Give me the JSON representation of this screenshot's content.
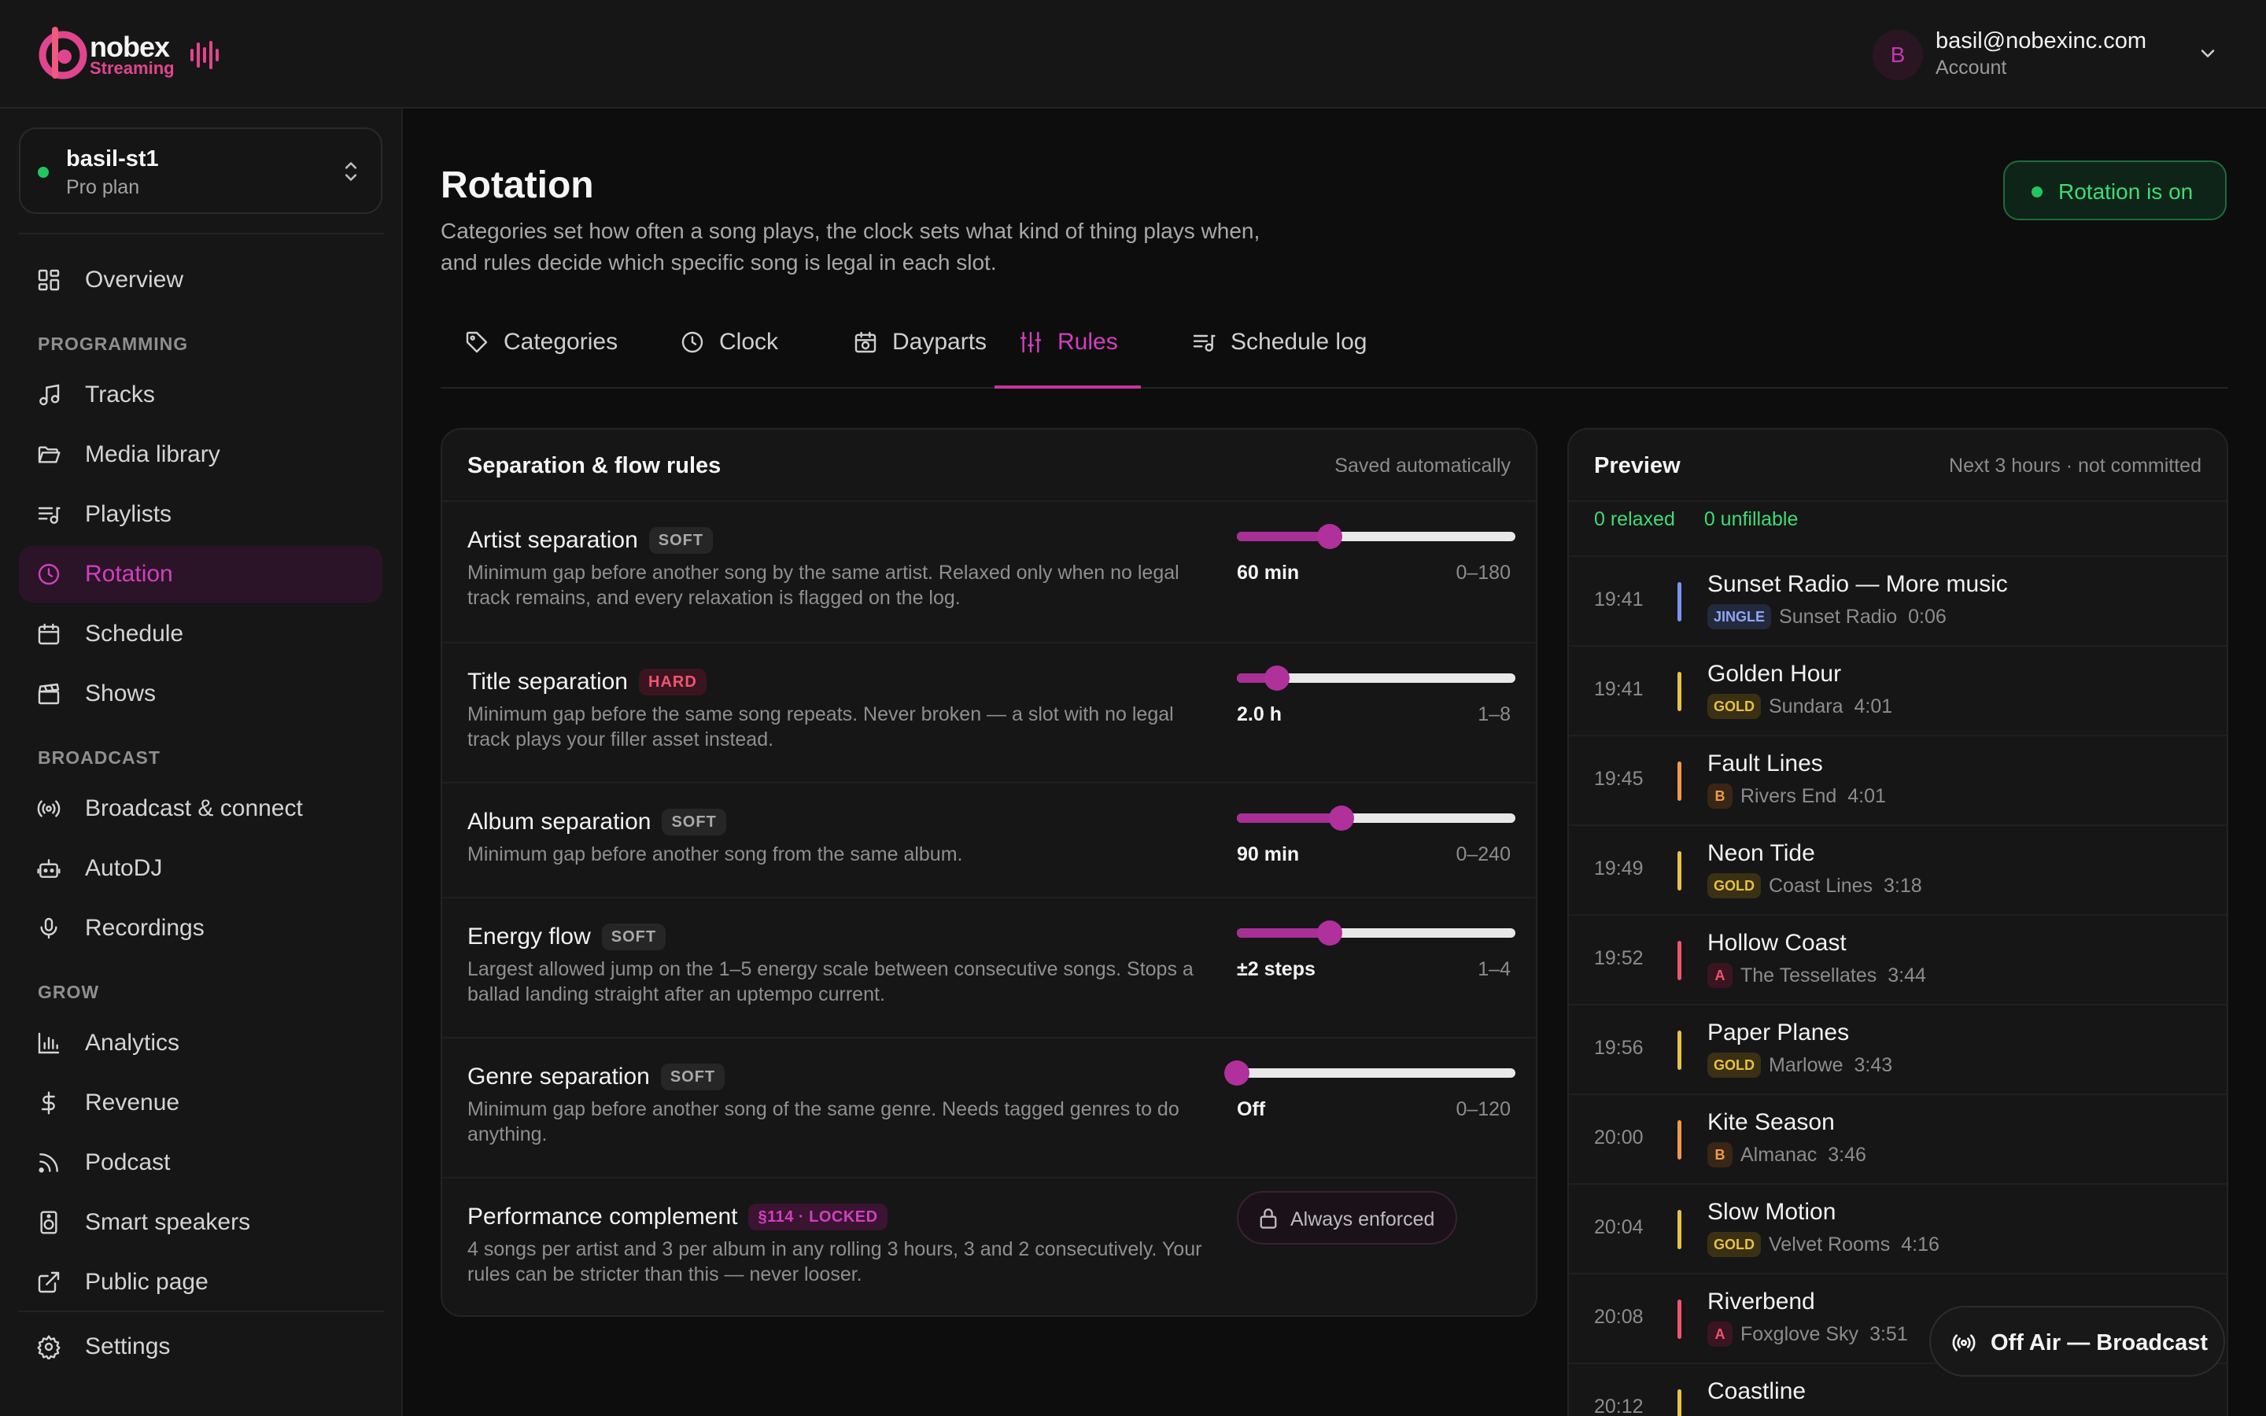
{
  "brand": {
    "name": "nobex",
    "sub": "Streaming"
  },
  "account": {
    "initial": "B",
    "email": "basil@nobexinc.com",
    "label": "Account"
  },
  "station": {
    "name": "basil-st1",
    "plan": "Pro plan",
    "status_color": "#22c55e"
  },
  "nav": {
    "overview": "Overview",
    "section_programming": "PROGRAMMING",
    "tracks": "Tracks",
    "media_library": "Media library",
    "playlists": "Playlists",
    "rotation": "Rotation",
    "schedule": "Schedule",
    "shows": "Shows",
    "section_broadcast": "BROADCAST",
    "broadcast_connect": "Broadcast & connect",
    "autodj": "AutoDJ",
    "recordings": "Recordings",
    "section_grow": "GROW",
    "analytics": "Analytics",
    "revenue": "Revenue",
    "podcast": "Podcast",
    "smart_speakers": "Smart speakers",
    "public_page": "Public page",
    "settings": "Settings"
  },
  "page": {
    "title": "Rotation",
    "description": "Categories set how often a song plays, the clock sets what kind of thing plays when, and rules decide which specific song is legal in each slot.",
    "status": "Rotation is on"
  },
  "tabs": [
    "Categories",
    "Clock",
    "Dayparts",
    "Rules",
    "Schedule log"
  ],
  "rules_panel": {
    "title": "Separation & flow rules",
    "meta": "Saved automatically",
    "rules": [
      {
        "name": "Artist separation",
        "tag": "SOFT",
        "desc": "Minimum gap before another song by the same artist. Relaxed only when no legal track remains, and every relaxation is flagged on the log.",
        "value": "60 min",
        "range": "0–180",
        "min": 0,
        "max": 180,
        "current": 60
      },
      {
        "name": "Title separation",
        "tag": "HARD",
        "desc": "Minimum gap before the same song repeats. Never broken — a slot with no legal track plays your filler asset instead.",
        "value": "2.0 h",
        "range": "1–8",
        "min": 1,
        "max": 8,
        "current": 2
      },
      {
        "name": "Album separation",
        "tag": "SOFT",
        "desc": "Minimum gap before another song from the same album.",
        "value": "90 min",
        "range": "0–240",
        "min": 0,
        "max": 240,
        "current": 90
      },
      {
        "name": "Energy flow",
        "tag": "SOFT",
        "desc": "Largest allowed jump on the 1–5 energy scale between consecutive songs. Stops a ballad landing straight after an uptempo current.",
        "value": "±2 steps",
        "range": "1–4",
        "min": 1,
        "max": 4,
        "current": 2
      },
      {
        "name": "Genre separation",
        "tag": "SOFT",
        "desc": "Minimum gap before another song of the same genre. Needs tagged genres to do anything.",
        "value": "Off",
        "range": "0–120",
        "min": 0,
        "max": 120,
        "current": 0
      }
    ],
    "complement": {
      "name": "Performance complement",
      "tag": "§114 · LOCKED",
      "desc": "4 songs per artist and 3 per album in any rolling 3 hours, 3 and 2 consecutively. Your rules can be stricter than this — never looser.",
      "button": "Always enforced"
    }
  },
  "preview": {
    "title": "Preview",
    "meta": "Next 3 hours · not committed",
    "relaxed": "0 relaxed",
    "unfillable": "0 unfillable",
    "items": [
      {
        "time": "19:41",
        "title": "Sunset Radio — More music",
        "badge": "JINGLE",
        "artist": "Sunset Radio",
        "duration": "0:06",
        "color": "#7b93f0"
      },
      {
        "time": "19:41",
        "title": "Golden Hour",
        "badge": "GOLD",
        "artist": "Sundara",
        "duration": "4:01",
        "color": "#e7c145"
      },
      {
        "time": "19:45",
        "title": "Fault Lines",
        "badge": "B",
        "artist": "Rivers End",
        "duration": "4:01",
        "color": "#ee9a4c"
      },
      {
        "time": "19:49",
        "title": "Neon Tide",
        "badge": "GOLD",
        "artist": "Coast Lines",
        "duration": "3:18",
        "color": "#e7c145"
      },
      {
        "time": "19:52",
        "title": "Hollow Coast",
        "badge": "A",
        "artist": "The Tessellates",
        "duration": "3:44",
        "color": "#f0556f"
      },
      {
        "time": "19:56",
        "title": "Paper Planes",
        "badge": "GOLD",
        "artist": "Marlowe",
        "duration": "3:43",
        "color": "#e7c145"
      },
      {
        "time": "20:00",
        "title": "Kite Season",
        "badge": "B",
        "artist": "Almanac",
        "duration": "3:46",
        "color": "#ee9a4c"
      },
      {
        "time": "20:04",
        "title": "Slow Motion",
        "badge": "GOLD",
        "artist": "Velvet Rooms",
        "duration": "4:16",
        "color": "#e7c145"
      },
      {
        "time": "20:08",
        "title": "Riverbend",
        "badge": "A",
        "artist": "Foxglove Sky",
        "duration": "3:51",
        "color": "#f0556f"
      },
      {
        "time": "20:12",
        "title": "Coastline",
        "badge": "",
        "artist": "",
        "duration": "",
        "color": "#e7c145"
      }
    ]
  },
  "broadcast_button": "Off Air — Broadcast",
  "colors": {
    "accent": "#c8349d",
    "on_air_green": "#22c55e",
    "background": "#0d0d0d",
    "panel": "#161616"
  }
}
